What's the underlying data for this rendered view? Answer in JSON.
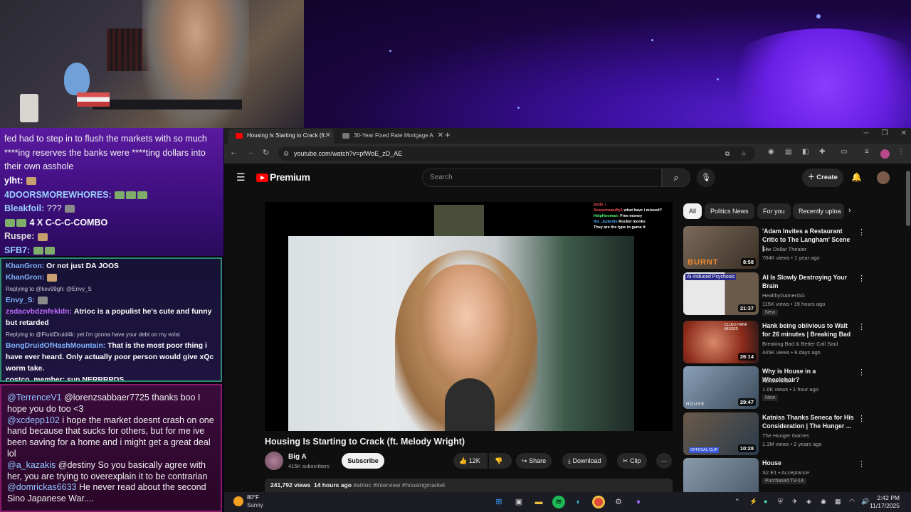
{
  "chat1": {
    "intro": "fed had to step in to flush the markets with so much ****ing reserves the banks were ****ting dollars into their own asshole",
    "lines": [
      {
        "user": "ylht:",
        "text": ""
      },
      {
        "user": "4DOORSMOREWHORES:",
        "text": ""
      },
      {
        "user": "Bleakfoil:",
        "text": "???"
      },
      {
        "user": "",
        "text": "4 X C-C-C-COMBO"
      },
      {
        "user": "Ruspe:",
        "text": ""
      },
      {
        "user": "SFB7:",
        "text": ""
      }
    ]
  },
  "chat2": {
    "lines": [
      {
        "user": "KhanGron:",
        "text": "Or not just DA JOOS",
        "reply": ""
      },
      {
        "user": "KhanGron:",
        "text": "",
        "reply": ""
      },
      {
        "user": "",
        "text": "",
        "reply": "Replying to @kev99gh: @Envy_S"
      },
      {
        "user": "Envy_S:",
        "text": "",
        "reply": ""
      },
      {
        "user": "zsdacvbdznfekldn:",
        "text": "Atrioc is a populist he's cute and funny but retarded",
        "reply": ""
      },
      {
        "user": "",
        "text": "",
        "reply": "Replying to @FluidDruid4k: yet i'm gonna have your debt on my wrist"
      },
      {
        "user": "BongDruidOfHashMountain:",
        "text": "That is the most poor thing i have ever heard. Only actually poor person would give xQc worm take.",
        "reply": ""
      },
      {
        "user": "costco_member:",
        "text": "sup NERRRRDS",
        "reply": ""
      }
    ]
  },
  "chat3": {
    "lines": [
      {
        "user": "@TerrenceV1",
        "text": "@lorenzsabbaer7725 thanks boo I hope you do too <3"
      },
      {
        "user": "@xcdepp102",
        "text": "i hope the market doesnt crash on one hand because that sucks for others, but for me ive been saving for a home and i might get a great deal lol"
      },
      {
        "user": "@a_kazakis",
        "text": "@destiny So you basically agree with her, you are trying to overexplain it to be contrarian"
      },
      {
        "user": "@domrickas6633",
        "text": "He never read about the second Sino Japanese War...."
      }
    ]
  },
  "browser": {
    "tabs": [
      {
        "label": "Housing Is Starting to Crack (ft.",
        "active": true,
        "favicon_color": "#ff0000"
      },
      {
        "label": "30-Year Fixed Rate Mortgage A",
        "active": false,
        "favicon_color": "#777777"
      }
    ],
    "new_tab": "+",
    "url": "youtube.com/watch?v=pfWoE_zD_AE"
  },
  "youtube": {
    "logo": "Premium",
    "search_placeholder": "Search",
    "create": "Create",
    "video": {
      "title": "Housing Is Starting to Crack (ft. Melody Wright)",
      "channel": "Big A",
      "subscribers": "415K subscribers",
      "subscribe": "Subscribe",
      "likes": "12K",
      "share": "Share",
      "download": "Download",
      "clip": "Clip",
      "views": "241,792 views",
      "age": "14 hours ago",
      "hashtags": "#atrioc #interview #housingmarket"
    },
    "overlay_chat": [
      {
        "name": "pudy_i",
        "text": ""
      },
      {
        "name": "Scarecrowuffy1",
        "text": "what have i missed?"
      },
      {
        "name": "HelpHooman:",
        "text": "Free money"
      },
      {
        "name": "the_Juden8s",
        "text": "Rocket monks"
      },
      {
        "name": "",
        "text": "They are the type to game it"
      }
    ],
    "chips": [
      "All",
      "Politics News",
      "For you",
      "Recently uploa"
    ],
    "recommendations": [
      {
        "title": "'Adam Invites a Restaurant Critic to The Langham' Scene |...",
        "channel": "The Dollar Theater",
        "meta": "704K views • 1 year ago",
        "tag": "",
        "duration": "8:58",
        "thumb_text": "BURNT",
        "thumb_color": "#5a4a3a"
      },
      {
        "title": "AI Is Slowly Destroying Your Brain",
        "channel": "HealthyGamerGG",
        "meta": "115K views • 19 hours ago",
        "tag": "New",
        "duration": "21:37",
        "thumb_text": "AI-Induced Psychosis",
        "thumb_color": "#c8c8c8"
      },
      {
        "title": "Hank being oblivious to Walt for 26 minutes | Breaking Bad",
        "channel": "Breaking Bad & Better Call Saul",
        "meta": "445K views • 8 days ago",
        "tag": "",
        "duration": "26:14",
        "thumb_text": "CLUES HANK MISSED",
        "thumb_color": "#8a3a2a"
      },
      {
        "title": "Why is House in a Wheelchair?",
        "channel": "House M.D.",
        "meta": "1.6K views • 1 hour ago",
        "tag": "New",
        "duration": "29:47",
        "thumb_text": "HOUSE",
        "thumb_color": "#4a6a8a"
      },
      {
        "title": "Katniss Thanks Seneca for His Consideration | The Hunger ...",
        "channel": "The Hunger Games",
        "meta": "1.3M views • 2 years ago",
        "tag": "",
        "duration": "10:28",
        "thumb_text": "OFFICIAL CLIP",
        "thumb_color": "#3a4a5a"
      },
      {
        "title": "House",
        "channel": "S2 E1 • Acceptance",
        "meta": "",
        "tag": "Purchased  TV-14",
        "duration": "",
        "thumb_text": "",
        "thumb_color": "#6a7a8a"
      }
    ]
  },
  "taskbar": {
    "temp": "80°F",
    "condition": "Sunny",
    "time": "2:42 PM",
    "date": "11/17/2025"
  }
}
